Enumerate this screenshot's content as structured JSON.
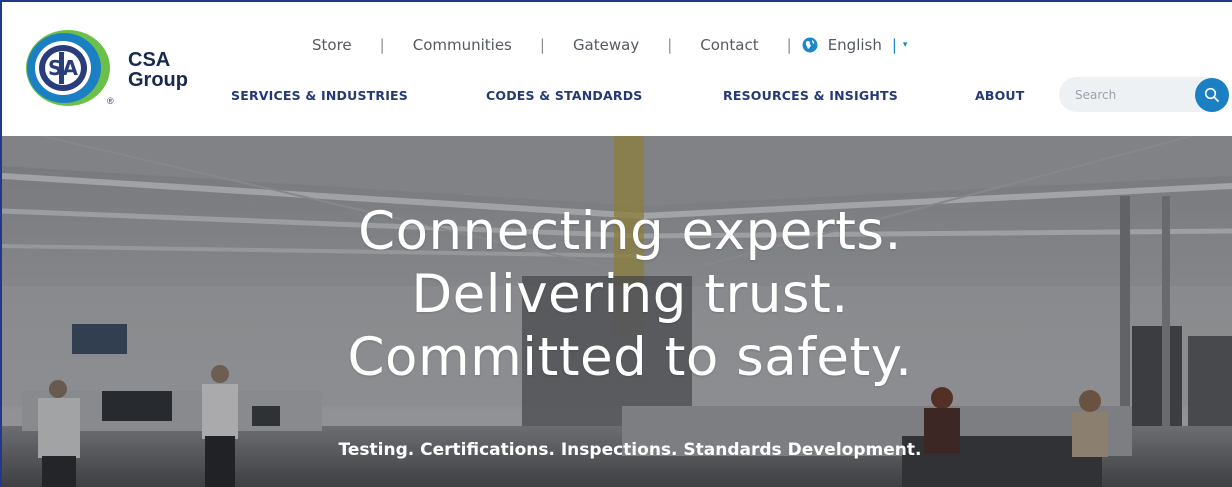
{
  "brand": {
    "name_line1": "CSA",
    "name_line2": "Group",
    "registered": "®",
    "colors": {
      "navy": "#233a75",
      "blue": "#1b7fc4",
      "green": "#6cc04a",
      "teal": "#1b89c9"
    }
  },
  "utility_nav": {
    "items": [
      "Store",
      "Communities",
      "Gateway",
      "Contact"
    ],
    "language": "English",
    "language_icon": "globe-icon",
    "separator": "|",
    "caret": "▾"
  },
  "main_nav": {
    "items": [
      "SERVICES & INDUSTRIES",
      "CODES & STANDARDS",
      "RESOURCES & INSIGHTS",
      "ABOUT"
    ]
  },
  "search": {
    "placeholder": "Search",
    "icon": "search-icon"
  },
  "hero": {
    "headline": [
      "Connecting experts.",
      "Delivering trust.",
      "Committed to safety."
    ],
    "tagline": "Testing. Certifications. Inspections. Standards Development."
  }
}
